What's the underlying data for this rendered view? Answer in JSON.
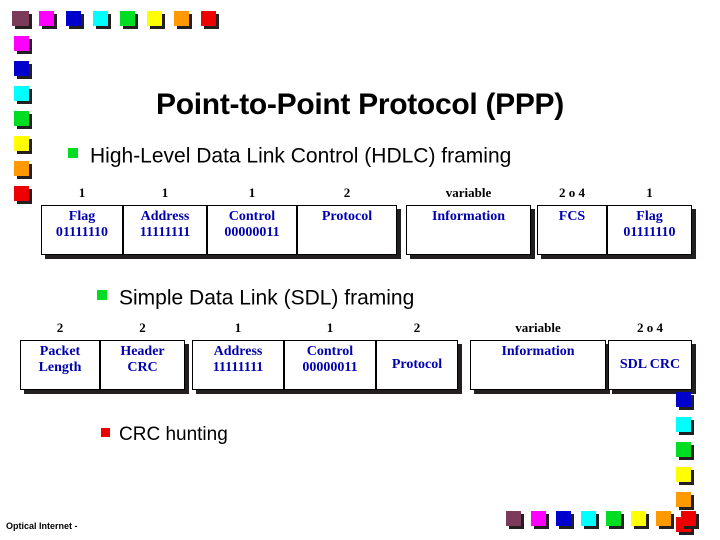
{
  "slide": {
    "title": "Point-to-Point Protocol (PPP)",
    "footer": "Optical Internet -"
  },
  "palette": {
    "plum": "#7c3a5a",
    "magenta": "#ff00ff",
    "blue": "#0000cc",
    "cyan": "#00ffff",
    "green": "#00dd22",
    "yellow": "#ffff00",
    "orange": "#ff9900",
    "red": "#ee0000",
    "shadow": "#231f20",
    "cell_text": "#0000b0",
    "header_text": "#000000"
  },
  "decor": {
    "top_row": [
      "plum",
      "magenta",
      "blue",
      "cyan",
      "green",
      "yellow",
      "orange",
      "red"
    ],
    "left_column": [
      "plum",
      "magenta",
      "blue",
      "cyan",
      "green",
      "yellow",
      "orange",
      "red"
    ],
    "right_column": [
      "blue",
      "cyan",
      "green",
      "yellow",
      "orange",
      "red"
    ],
    "bottom_row": [
      "plum",
      "magenta",
      "blue",
      "cyan",
      "green",
      "yellow",
      "orange",
      "red"
    ]
  },
  "bullets": [
    {
      "marker_color": "green",
      "text": "High-Level Data Link Control (HDLC) framing"
    },
    {
      "marker_color": "green",
      "text": "Simple Data Link (SDL) framing"
    },
    {
      "marker_color": "red",
      "text": "CRC hunting"
    }
  ],
  "hdlc_frame": {
    "fields": [
      {
        "size": "1",
        "lines": [
          "Flag",
          "01111110"
        ],
        "align": "top"
      },
      {
        "size": "1",
        "lines": [
          "Address",
          "11111111"
        ],
        "align": "top"
      },
      {
        "size": "1",
        "lines": [
          "Control",
          "00000011"
        ],
        "align": "top"
      },
      {
        "size": "2",
        "lines": [
          "Protocol"
        ],
        "align": "top"
      },
      {
        "size": "variable",
        "lines": [
          "Information"
        ],
        "align": "top"
      },
      {
        "size": "2 o 4",
        "lines": [
          "FCS"
        ],
        "align": "top"
      },
      {
        "size": "1",
        "lines": [
          "Flag",
          "01111110"
        ],
        "align": "top"
      }
    ]
  },
  "sdl_frame": {
    "fields": [
      {
        "size": "2",
        "lines": [
          "Packet",
          "Length"
        ],
        "align": "top"
      },
      {
        "size": "2",
        "lines": [
          "Header",
          "CRC"
        ],
        "align": "top"
      },
      {
        "size": "1",
        "lines": [
          "Address",
          "11111111"
        ],
        "align": "top"
      },
      {
        "size": "1",
        "lines": [
          "Control",
          "00000011"
        ],
        "align": "top"
      },
      {
        "size": "2",
        "lines": [
          "Protocol"
        ],
        "align": "middle"
      },
      {
        "size": "variable",
        "lines": [
          "Information"
        ],
        "align": "top"
      },
      {
        "size": "2 o 4",
        "lines": [
          "SDL CRC"
        ],
        "align": "middle"
      }
    ]
  }
}
